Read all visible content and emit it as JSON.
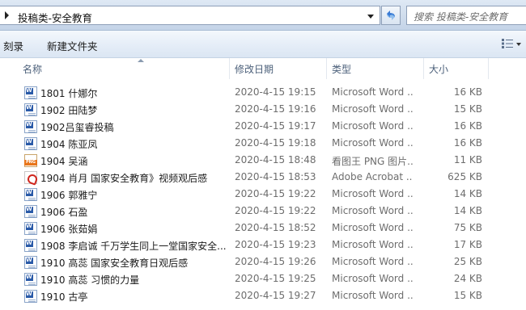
{
  "address": {
    "path": "投稿类-安全教育"
  },
  "search": {
    "placeholder": "搜索 投稿类-安全教育"
  },
  "toolbar": {
    "burn_label": "刻录",
    "new_folder_label": "新建文件夹"
  },
  "columns": {
    "name": "名称",
    "modified": "修改日期",
    "type": "类型",
    "size": "大小"
  },
  "files": [
    {
      "name": "1801 什娜尔",
      "modified": "2020-4-15 19:15",
      "type": "Microsoft Word ...",
      "size": "16 KB",
      "icon": "word-doc-icon"
    },
    {
      "name": "1902 田陆梦",
      "modified": "2020-4-15 19:16",
      "type": "Microsoft Word ...",
      "size": "15 KB",
      "icon": "word-doc-icon"
    },
    {
      "name": "1902吕玺睿投稿",
      "modified": "2020-4-15 19:17",
      "type": "Microsoft Word ...",
      "size": "16 KB",
      "icon": "word-doc-icon"
    },
    {
      "name": "1904 陈亚凤",
      "modified": "2020-4-15 19:18",
      "type": "Microsoft Word ...",
      "size": "16 KB",
      "icon": "word-doc-icon"
    },
    {
      "name": "1904 吴涵",
      "modified": "2020-4-15 18:48",
      "type": "看图王 PNG 图片...",
      "size": "11 KB",
      "icon": "png-image-icon"
    },
    {
      "name": "1904 肖月 国家安全教育》视频观后感",
      "modified": "2020-4-15 18:53",
      "type": "Adobe Acrobat ...",
      "size": "625 KB",
      "icon": "pdf-icon"
    },
    {
      "name": "1906 郭雅宁",
      "modified": "2020-4-15 19:22",
      "type": "Microsoft Word ...",
      "size": "14 KB",
      "icon": "word-doc-icon"
    },
    {
      "name": "1906 石盈",
      "modified": "2020-4-15 19:22",
      "type": "Microsoft Word ...",
      "size": "14 KB",
      "icon": "word-doc-icon"
    },
    {
      "name": "1906 张茹娟",
      "modified": "2020-4-15 18:52",
      "type": "Microsoft Word ...",
      "size": "75 KB",
      "icon": "word-doc-icon"
    },
    {
      "name": "1908 李启诚 千万学生同上一堂国家安全...",
      "modified": "2020-4-15 19:23",
      "type": "Microsoft Word ...",
      "size": "17 KB",
      "icon": "word-doc-icon"
    },
    {
      "name": "1910 高蕊 国家安全教育日观后感",
      "modified": "2020-4-15 19:26",
      "type": "Microsoft Word ...",
      "size": "25 KB",
      "icon": "word-doc-icon"
    },
    {
      "name": "1910 高蕊 习惯的力量",
      "modified": "2020-4-15 19:25",
      "type": "Microsoft Word ...",
      "size": "24 KB",
      "icon": "word-doc-icon"
    },
    {
      "name": "1910 古亭",
      "modified": "2020-4-15 19:27",
      "type": "Microsoft Word ...",
      "size": "15 KB",
      "icon": "word-doc-icon"
    }
  ]
}
